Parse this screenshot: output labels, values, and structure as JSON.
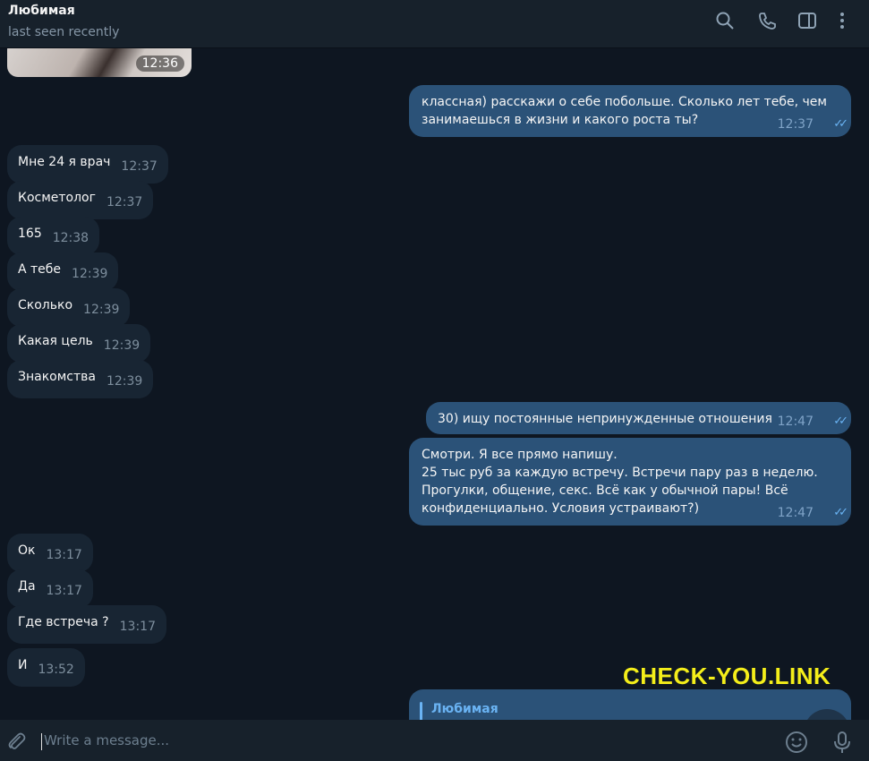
{
  "header": {
    "name": "Любимая",
    "status": "last seen recently"
  },
  "icons": {
    "search": "search-icon",
    "call": "phone-icon",
    "sidebar": "sidebar-toggle-icon",
    "more": "more-vertical-icon",
    "attach": "paperclip-icon",
    "emoji": "emoji-icon",
    "mic": "microphone-icon"
  },
  "messages": {
    "media_time": "12:36",
    "m1": {
      "text_line1": "классная) расскажи о себе побольше. Сколько лет тебе, чем",
      "text_line2": "занимаешься в жизни и какого роста ты?",
      "time": "12:37"
    },
    "m2": {
      "text": "Мне 24 я врач",
      "time": "12:37"
    },
    "m3": {
      "text": "Косметолог",
      "time": "12:37"
    },
    "m4": {
      "text": "165",
      "time": "12:38"
    },
    "m5": {
      "text": "А тебе",
      "time": "12:39"
    },
    "m6": {
      "text": "Сколько",
      "time": "12:39"
    },
    "m7": {
      "text": "Какая цель",
      "time": "12:39"
    },
    "m8": {
      "text": "Знакомства",
      "time": "12:39"
    },
    "m9": {
      "text": "30) ищу постоянные непринужденные отношения",
      "time": "12:47"
    },
    "m10": {
      "line1": "Смотри. Я все прямо напишу.",
      "line2": "25 тыс руб за каждую встречу. Встречи пару раз в неделю.",
      "line3": "Прогулки, общение, секс. Всё как у обычной пары! Всё",
      "line4": "конфиденциально. Условия устраивают?)",
      "time": "12:47"
    },
    "m11": {
      "text": "Ок",
      "time": "13:17"
    },
    "m12": {
      "text": "Да",
      "time": "13:17"
    },
    "m13": {
      "text": "Где встреча ?",
      "time": "13:17"
    },
    "m14": {
      "text": "И",
      "time": "13:52"
    },
    "reply_name": "Любимая"
  },
  "watermark": "CHECK-YOU.LINK",
  "composer": {
    "placeholder": "Write a message..."
  },
  "colors": {
    "background": "#0e1621",
    "header": "#17212b",
    "incoming_bubble": "#182533",
    "outgoing_bubble": "#2b5278",
    "accent": "#6ab3f3",
    "watermark": "#f4ee1a"
  }
}
